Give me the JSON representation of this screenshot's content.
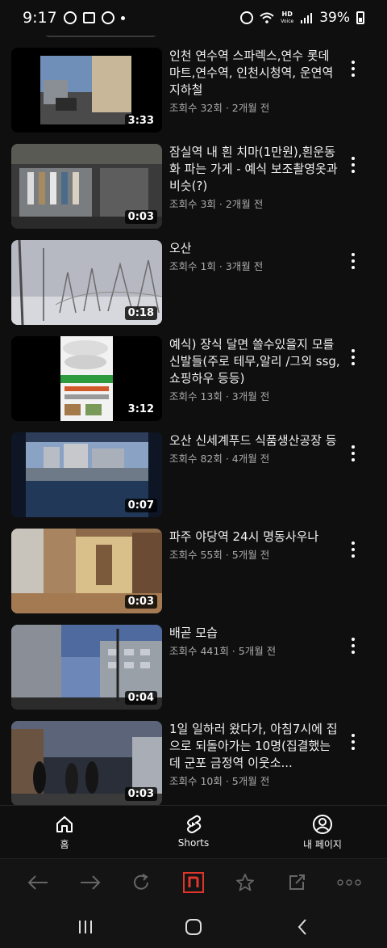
{
  "status_bar": {
    "time": "9:17",
    "network_label_top": "HD",
    "network_label_bottom": "Voice",
    "battery": "39%"
  },
  "videos": [
    {
      "title": "인천 연수역 스파렉스,연수 롯데마트,연수역, 인천시청역, 운연역 지하철",
      "meta": "조회수 32회 · 2개월 전",
      "duration": "3:33"
    },
    {
      "title": "잠실역 내 흰 치마(1만원),흰운동화 파는 가게 - 예식 보조촬영옷과 비슷(?)",
      "meta": "조회수 3회 · 2개월 전",
      "duration": "0:03"
    },
    {
      "title": "오산",
      "meta": "조회수 1회 · 3개월 전",
      "duration": "0:18"
    },
    {
      "title": "예식) 장식 달면 쓸수있을지 모를 신발들(주로 테무,알리 /그외 ssg,쇼핑하우 등등)",
      "meta": "조회수 13회 · 3개월 전",
      "duration": "3:12"
    },
    {
      "title": "오산 신세계푸드 식품생산공장 등",
      "meta": "조회수 82회 · 4개월 전",
      "duration": "0:07"
    },
    {
      "title": "파주 야당역 24시 명동사우나",
      "meta": "조회수 55회 · 5개월 전",
      "duration": "0:03"
    },
    {
      "title": "배곧 모습",
      "meta": "조회수 441회 · 5개월 전",
      "duration": "0:04"
    },
    {
      "title": "1일 일하러 왔다가, 아침7시에 집으로 되돌아가는 10명(집결했는데 군포 금정역 이웃소...",
      "meta": "조회수 10회 · 5개월 전",
      "duration": "0:03"
    }
  ],
  "bottom_nav": {
    "home": "홈",
    "shorts": "Shorts",
    "my_page": "내 페이지"
  },
  "colors": {
    "background": "#0f0f0f",
    "secondary_text": "#aaaaaa",
    "browser_accent": "#e0352b"
  },
  "icons": [
    "back-arrow-icon",
    "forward-arrow-icon",
    "refresh-icon",
    "naver-n-icon",
    "star-icon",
    "share-icon",
    "more-dots-icon"
  ]
}
